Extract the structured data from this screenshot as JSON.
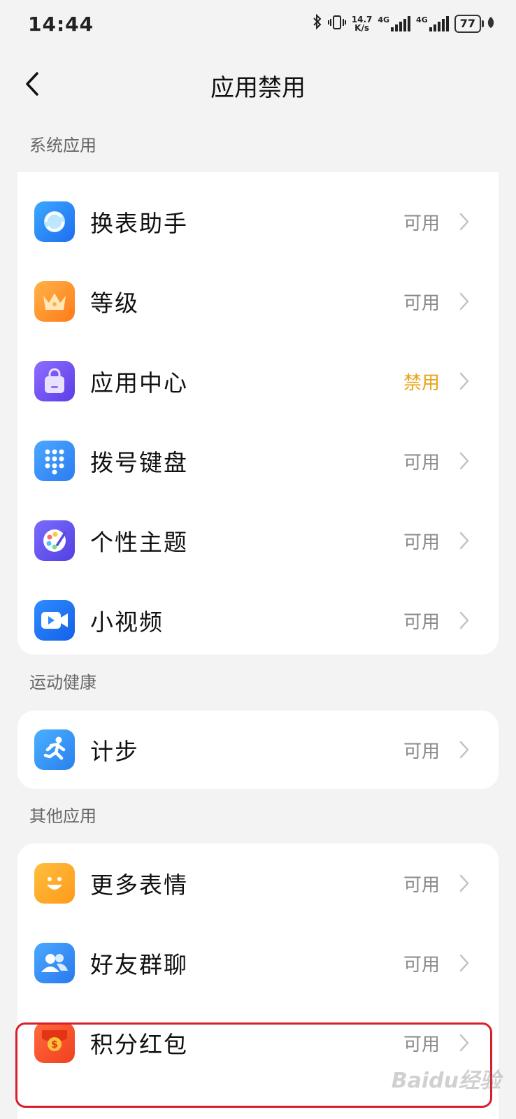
{
  "status_bar": {
    "time": "14:44",
    "net_speed_value": "14.7",
    "net_speed_unit": "K/s",
    "sig1_label": "4G",
    "sig2_label": "4G",
    "battery": "77"
  },
  "header": {
    "title": "应用禁用"
  },
  "sections": [
    {
      "label": "系统应用",
      "items": [
        {
          "name": "换表助手",
          "status": "可用"
        },
        {
          "name": "等级",
          "status": "可用"
        },
        {
          "name": "应用中心",
          "status": "禁用"
        },
        {
          "name": "拨号键盘",
          "status": "可用"
        },
        {
          "name": "个性主题",
          "status": "可用"
        },
        {
          "name": "小视频",
          "status": "可用"
        }
      ]
    },
    {
      "label": "运动健康",
      "items": [
        {
          "name": "计步",
          "status": "可用"
        }
      ]
    },
    {
      "label": "其他应用",
      "items": [
        {
          "name": "更多表情",
          "status": "可用"
        },
        {
          "name": "好友群聊",
          "status": "可用"
        },
        {
          "name": "积分红包",
          "status": "可用"
        }
      ]
    }
  ],
  "icons": {
    "swap_watch": "swap-watch-icon",
    "level": "crown-icon",
    "app_center": "shopping-bag-icon",
    "dialpad": "dialpad-icon",
    "theme": "palette-icon",
    "video": "video-camera-icon",
    "steps": "running-person-icon",
    "emoji": "smiley-icon",
    "group_chat": "friends-icon",
    "red_packet": "red-packet-icon"
  },
  "colors": {
    "disabled_status": "#e8a317",
    "enabled_status": "#8a8a8a",
    "highlight_border": "#d9202a"
  },
  "watermark": "Baidu经验"
}
